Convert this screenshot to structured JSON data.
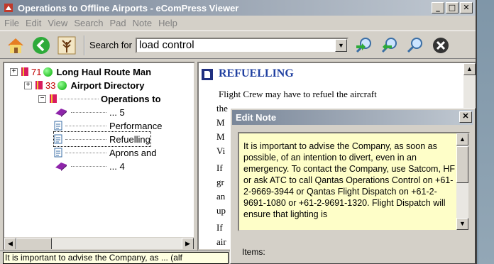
{
  "window": {
    "title": "Operations to Offline Airports - eComPress Viewer"
  },
  "menu": [
    "File",
    "Edit",
    "View",
    "Search",
    "Pad",
    "Note",
    "Help"
  ],
  "toolbar": {
    "search_label": "Search for",
    "search_value": "load control"
  },
  "tree": {
    "rows": [
      {
        "count": "71",
        "label": "Long Haul Route Man"
      },
      {
        "count": "33",
        "label": "Airport Directory"
      },
      {
        "label": "Operations to"
      },
      {
        "label": "... 5"
      },
      {
        "label": "Performance"
      },
      {
        "label": "Refuelling"
      },
      {
        "label": "Aprons and"
      },
      {
        "label": "... 4"
      }
    ]
  },
  "reader": {
    "title": "REFUELLING",
    "lines": [
      "Flight Crew may have to refuel the aircraft",
      "the",
      "M",
      "M",
      "Vi",
      "If",
      "gr",
      "an",
      "up",
      "If",
      "air"
    ]
  },
  "tooltip": "It is important to advise the Company, as ... (alf",
  "dialog": {
    "title": "Edit Note",
    "note": "It is important to advise the Company, as soon as possible, of an intention to divert, even in an emergency. To contact the Company, use Satcom, HF or ask ATC to call Qantas Operations Control on +61-2-9669-3944 or Qantas Flight Dispatch on +61-2-9691-1080 or +61-2-9691-1320. Flight Dispatch will ensure that lighting is",
    "items_label": "Items:"
  }
}
